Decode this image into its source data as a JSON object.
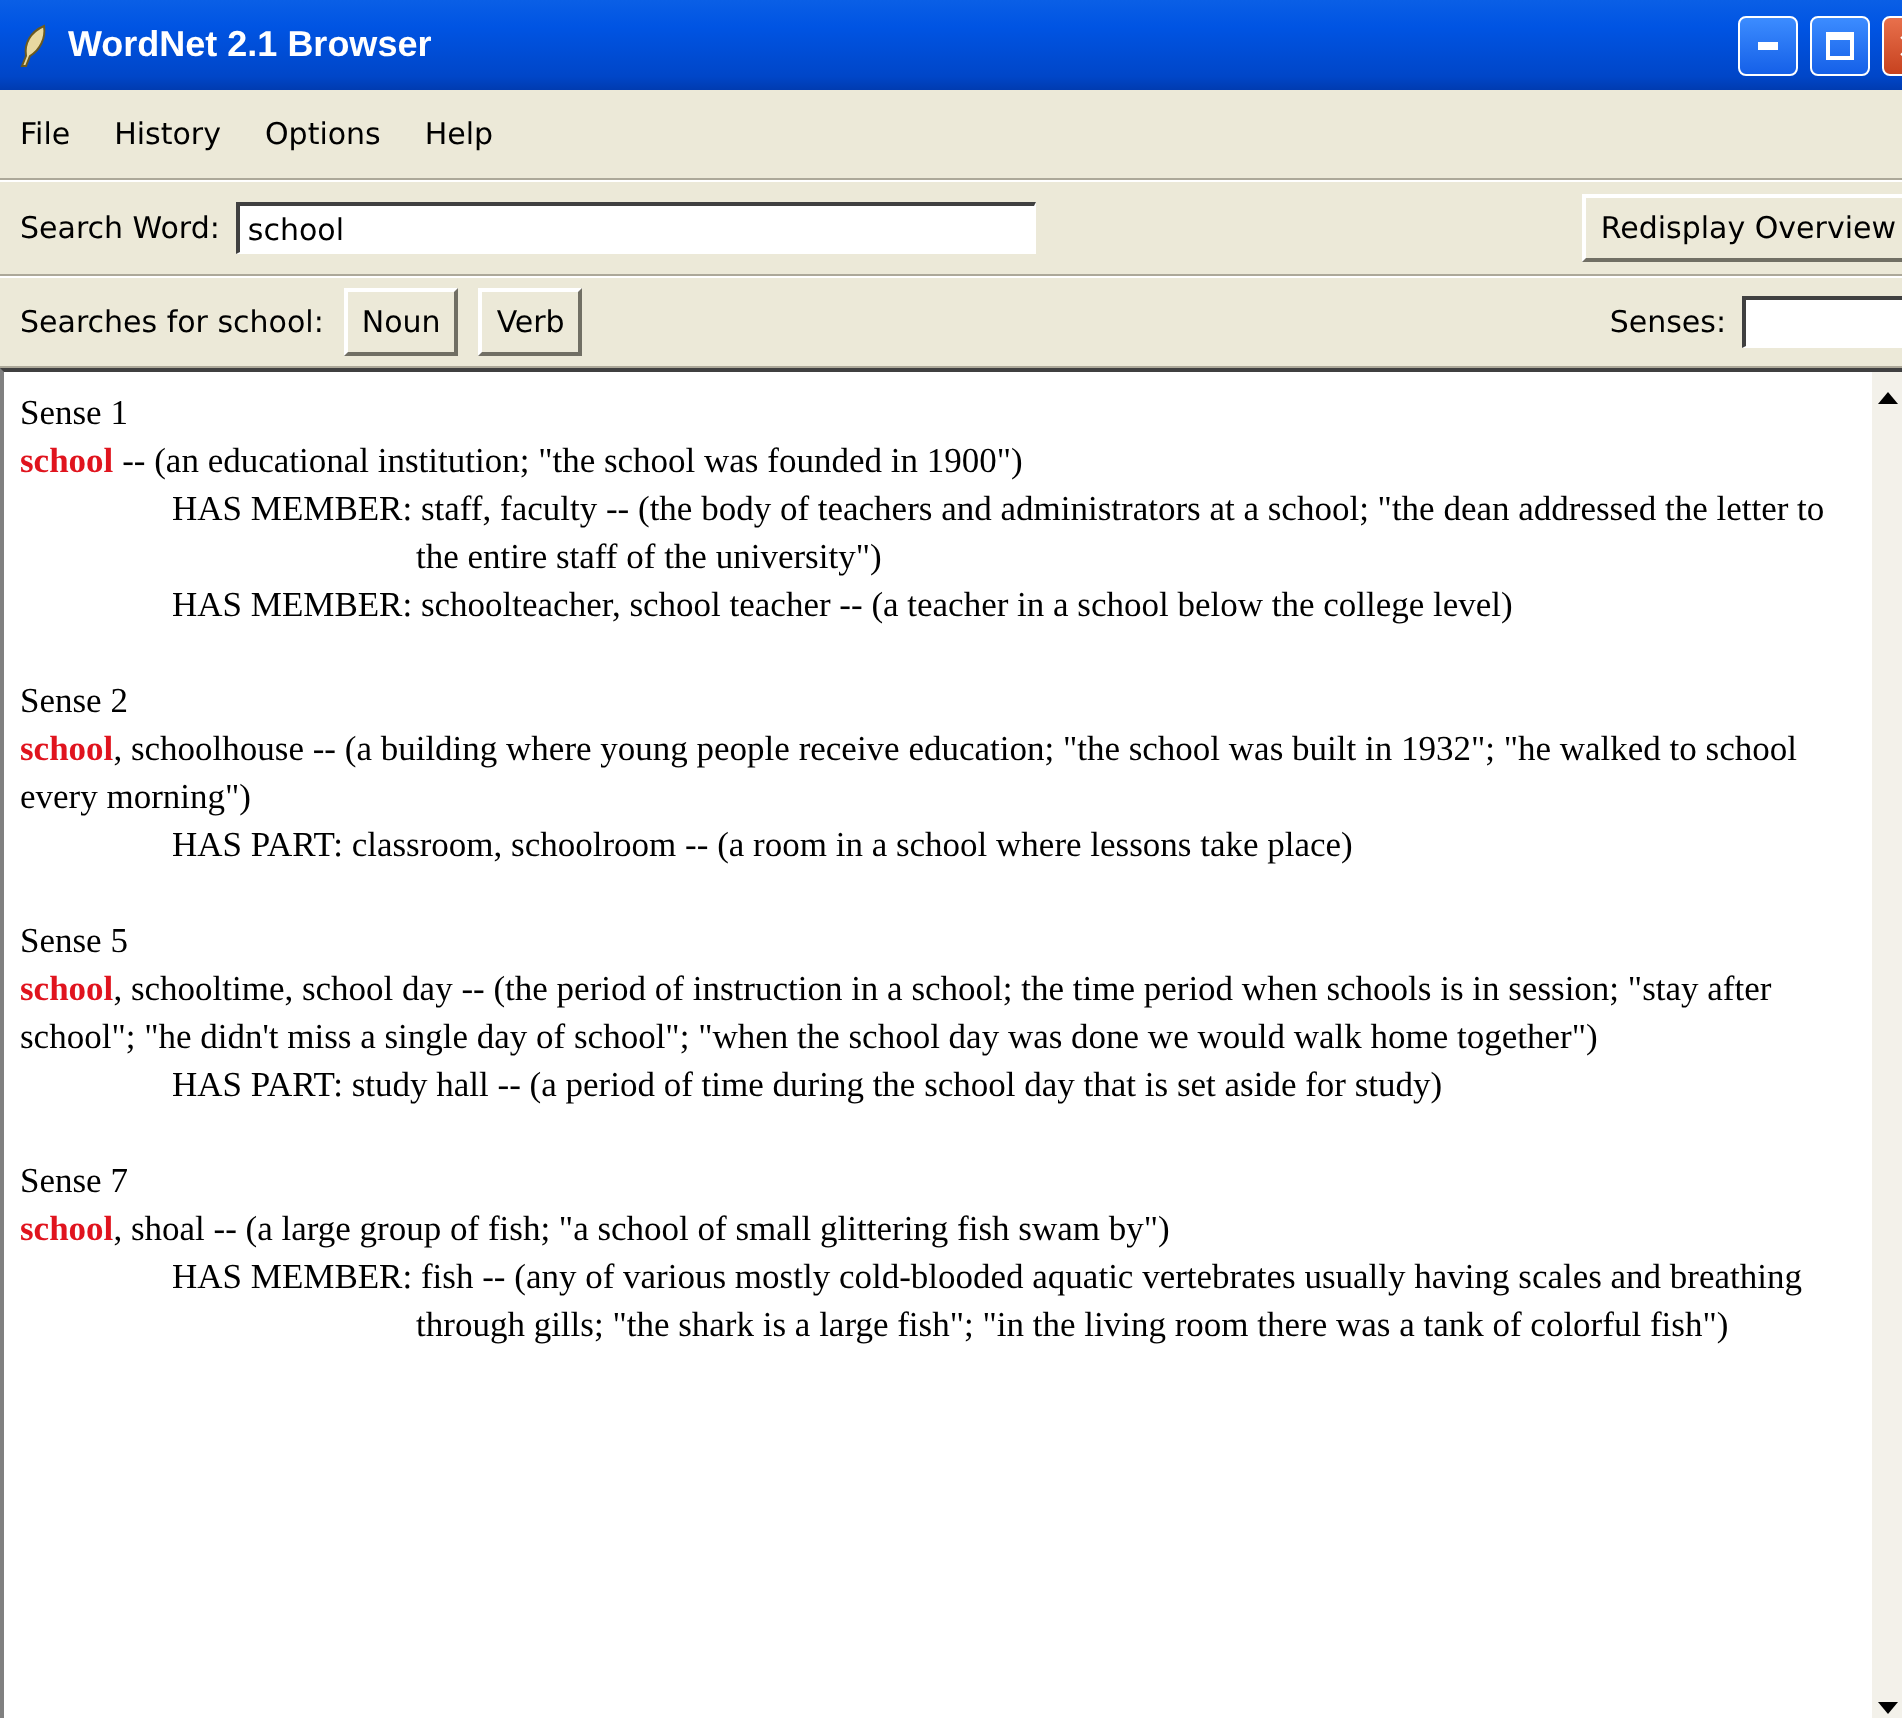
{
  "window": {
    "title": "WordNet 2.1 Browser"
  },
  "menu": [
    "File",
    "History",
    "Options",
    "Help"
  ],
  "search": {
    "label": "Search Word:",
    "value": "school",
    "button": "Redisplay Overview"
  },
  "searches": {
    "label": "Searches for school:",
    "buttons": [
      "Noun",
      "Verb"
    ],
    "senses_label": "Senses:"
  },
  "senses": [
    {
      "label": "Sense 1",
      "head": "**school** -- (an educational institution; \"the school was founded in 1900\")",
      "relations": [
        "HAS MEMBER: staff, faculty -- (the body of teachers and administrators at a school; \"the dean addressed the letter to the entire staff of the university\")",
        "HAS MEMBER: schoolteacher, school teacher -- (a teacher in a school below the college level)"
      ]
    },
    {
      "label": "Sense 2",
      "head": "**school**, schoolhouse -- (a building where young people receive education; \"the school was built in 1932\"; \"he walked to school every morning\")",
      "relations": [
        "HAS PART: classroom, schoolroom -- (a room in a school where lessons take place)"
      ]
    },
    {
      "label": "Sense 5",
      "head": "**school**, schooltime, school day -- (the period of instruction in a school; the time period when schools is in session; \"stay after school\"; \"he didn't miss a single day of school\"; \"when the school day was done we would walk home together\")",
      "relations": [
        "HAS PART: study hall -- (a period of time during the school day that is set aside for study)"
      ]
    },
    {
      "label": "Sense 7",
      "head": "**school**, shoal -- (a large group of fish; \"a school of small glittering fish swam by\")",
      "relations": [
        "HAS MEMBER: fish -- (any of various mostly cold-blooded aquatic vertebrates usually having scales and breathing through gills; \"the shark is a large fish\"; \"in the living room there was a tank of colorful fish\")"
      ]
    }
  ]
}
